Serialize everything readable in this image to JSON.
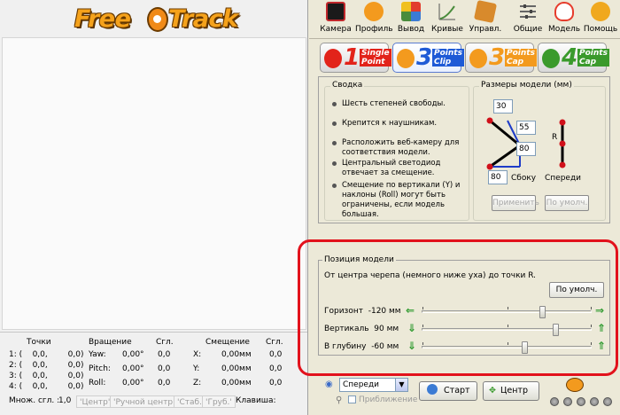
{
  "app": {
    "logo_text_1": "Free",
    "logo_text_2": "Track"
  },
  "toolbar": {
    "items": [
      {
        "label": "Камера",
        "icon": "camera-icon",
        "color": "#c0282c"
      },
      {
        "label": "Профиль",
        "icon": "profile-icon",
        "color": "#f39a1e"
      },
      {
        "label": "Вывод",
        "icon": "output-icon",
        "color": "#3b7bd4"
      },
      {
        "label": "Кривые",
        "icon": "curves-icon",
        "color": "#4a8c3c"
      },
      {
        "label": "Управл.",
        "icon": "control-icon",
        "color": "#d88a2c"
      },
      {
        "label": "Общие",
        "icon": "general-icon",
        "color": "#7a7a7a"
      },
      {
        "label": "Модель",
        "icon": "model-icon",
        "color": "#e63c2c"
      },
      {
        "label": "Помощь",
        "icon": "help-icon",
        "color": "#f0a81e"
      }
    ]
  },
  "model_tabs": [
    {
      "num": "1",
      "title1": "Single",
      "title2": "Point",
      "color": "#e2231a"
    },
    {
      "num": "3",
      "title1": "Points",
      "title2": "Clip",
      "color": "#1e5ad6"
    },
    {
      "num": "3",
      "title1": "Points",
      "title2": "Cap",
      "color": "#f39a1e"
    },
    {
      "num": "4",
      "title1": "Points",
      "title2": "Cap",
      "color": "#3a9a2c"
    }
  ],
  "summary": {
    "title": "Сводка",
    "bullets": [
      "Шесть степеней свободы.",
      "Крепится к наушникам.",
      "Расположить веб-камеру для соответствия модели.",
      "Центральный светодиод отвечает за смещение.",
      "Смещение по вертикали (Y) и наклоны (Roll) могут быть ограничены, если модель большая."
    ]
  },
  "dimensions": {
    "title": "Размеры модели (мм)",
    "v30": "30",
    "v55": "55",
    "v80a": "80",
    "v80b": "80",
    "side_label": "Сбоку",
    "front_label": "Спереди",
    "r_label": "R",
    "apply": "Применить",
    "default": "По умолч."
  },
  "position": {
    "title": "Позиция модели",
    "desc": "От центра черепа (немного ниже уха) до точки R.",
    "default": "По умолч.",
    "rows": [
      {
        "label": "Горизонт",
        "value": "-120 мм",
        "fraction": 0.72
      },
      {
        "label": "Вертикаль",
        "value": "90 мм",
        "fraction": 0.8
      },
      {
        "label": "В глубину",
        "value": "-60 мм",
        "fraction": 0.61
      }
    ]
  },
  "bottom": {
    "view": "Спереди",
    "zoom": "Приближение",
    "start": "Старт",
    "center": "Центр"
  },
  "stats": {
    "h_points": "Точки",
    "h_rot": "Вращение",
    "h_sgl1": "Сгл.",
    "h_shift": "Смещение",
    "h_sgl2": "Сгл.",
    "points": [
      "1: (    0,0,        0,0)",
      "2: (    0,0,        0,0)",
      "3: (    0,0,        0,0)",
      "4: (    0,0,        0,0)"
    ],
    "rot": [
      {
        "axis": "Yaw:",
        "value": "0,00°",
        "sgl": "0,0"
      },
      {
        "axis": "Pitch:",
        "value": "0,00°",
        "sgl": "0,0"
      },
      {
        "axis": "Roll:",
        "value": "0,00°",
        "sgl": "0,0"
      }
    ],
    "shift": [
      {
        "axis": "X:",
        "value": "0,00мм",
        "sgl": "0,0"
      },
      {
        "axis": "Y:",
        "value": "0,00мм",
        "sgl": "0,0"
      },
      {
        "axis": "Z:",
        "value": "0,00мм",
        "sgl": "0,0"
      }
    ],
    "mult_label": "Множ. сгл. :",
    "mult_value": "1,0",
    "status_items": [
      "'Центр'",
      "'Ручной центр'",
      "'Стаб.'",
      "'Груб.'"
    ],
    "key_label": "Клавиша:"
  }
}
